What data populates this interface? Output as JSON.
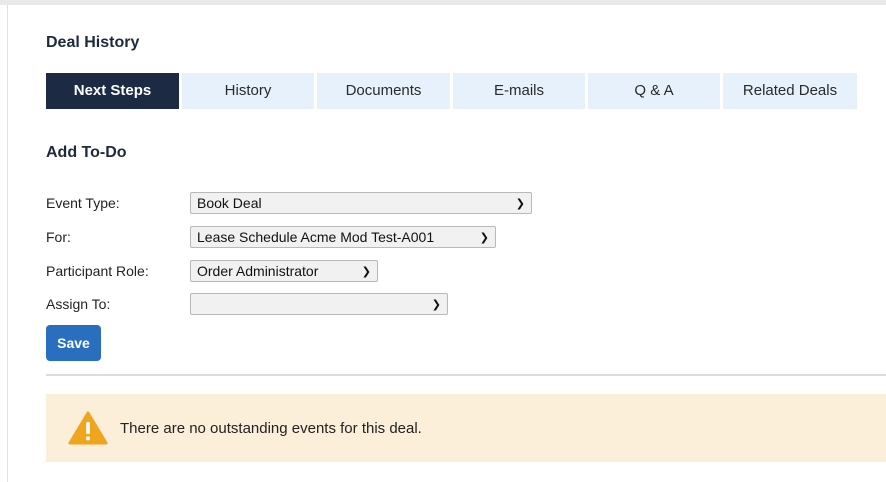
{
  "header": {
    "title": "Deal History"
  },
  "tabs": [
    {
      "label": "Next Steps",
      "active": true
    },
    {
      "label": "History"
    },
    {
      "label": "Documents"
    },
    {
      "label": "E-mails"
    },
    {
      "label": "Q & A"
    },
    {
      "label": "Related Deals"
    }
  ],
  "form": {
    "title": "Add To-Do",
    "fields": {
      "event_type": {
        "label": "Event Type:",
        "value": "Book Deal"
      },
      "for": {
        "label": "For:",
        "value": "Lease Schedule Acme Mod Test-A001"
      },
      "participant_role": {
        "label": "Participant Role:",
        "value": "Order Administrator"
      },
      "assign_to": {
        "label": "Assign To:",
        "value": ""
      }
    },
    "save_label": "Save"
  },
  "alert": {
    "icon": "warning-icon",
    "message": "There are no outstanding events for this deal."
  },
  "colors": {
    "active_tab": "#1c2a44",
    "tab_bg": "#e7f1fb",
    "save_button": "#2a6ec0",
    "alert_bg": "#fcefd9",
    "warning_icon": "#f0a51f"
  }
}
